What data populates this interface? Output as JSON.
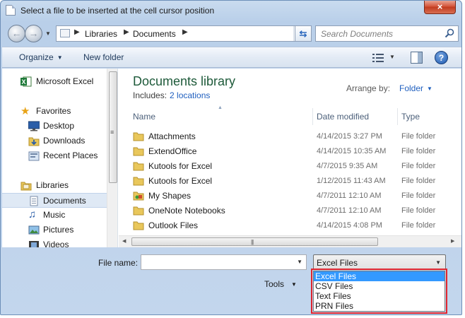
{
  "window": {
    "title": "Select a file to be inserted at the cell cursor position",
    "close_glyph": "×"
  },
  "nav": {
    "back_glyph": "←",
    "forward_glyph": "→",
    "breadcrumbs": [
      "Libraries",
      "Documents"
    ],
    "search_placeholder": "Search Documents"
  },
  "toolbar": {
    "organize_label": "Organize",
    "new_folder_label": "New folder",
    "help_glyph": "?"
  },
  "sidebar": {
    "items": [
      {
        "label": "Microsoft Excel",
        "icon": "excel-icon"
      },
      {
        "label": "Favorites",
        "icon": "star-icon"
      },
      {
        "label": "Desktop",
        "icon": "desktop-icon"
      },
      {
        "label": "Downloads",
        "icon": "downloads-icon"
      },
      {
        "label": "Recent Places",
        "icon": "recent-places-icon"
      },
      {
        "label": "Libraries",
        "icon": "libraries-icon"
      },
      {
        "label": "Documents",
        "icon": "documents-icon",
        "selected": true
      },
      {
        "label": "Music",
        "icon": "music-icon"
      },
      {
        "label": "Pictures",
        "icon": "pictures-icon"
      },
      {
        "label": "Videos",
        "icon": "videos-icon"
      }
    ]
  },
  "library": {
    "title": "Documents library",
    "includes_label": "Includes:",
    "includes_link": "2 locations",
    "arrange_label": "Arrange by:",
    "arrange_value": "Folder"
  },
  "columns": {
    "name": "Name",
    "date": "Date modified",
    "type": "Type"
  },
  "files": [
    {
      "name": "Attachments",
      "date": "4/14/2015 3:27 PM",
      "type": "File folder",
      "icon": "folder-icon"
    },
    {
      "name": "ExtendOffice",
      "date": "4/14/2015 10:35 AM",
      "type": "File folder",
      "icon": "folder-icon"
    },
    {
      "name": "Kutools for Excel",
      "date": "4/7/2015 9:35 AM",
      "type": "File folder",
      "icon": "folder-icon"
    },
    {
      "name": "Kutools for Excel",
      "date": "1/12/2015 11:43 AM",
      "type": "File folder",
      "icon": "folder-icon"
    },
    {
      "name": "My Shapes",
      "date": "4/7/2011 12:10 AM",
      "type": "File folder",
      "icon": "shapes-folder-icon"
    },
    {
      "name": "OneNote Notebooks",
      "date": "4/7/2011 12:10 AM",
      "type": "File folder",
      "icon": "folder-icon"
    },
    {
      "name": "Outlook Files",
      "date": "4/14/2015 4:08 PM",
      "type": "File folder",
      "icon": "folder-icon"
    }
  ],
  "bottom": {
    "file_name_label": "File name:",
    "file_name_value": "",
    "file_type_value": "Excel Files",
    "tools_label": "Tools"
  },
  "dropdown": {
    "options": [
      "Excel Files",
      "CSV Files",
      "Text Files",
      "PRN Files"
    ],
    "selected_index": 0
  },
  "colors": {
    "library_title": "#1e5a3a",
    "link": "#1f5fbf",
    "selection": "#3399ff",
    "highlight_box": "#e0262e",
    "close_button": "#c13b1f"
  }
}
